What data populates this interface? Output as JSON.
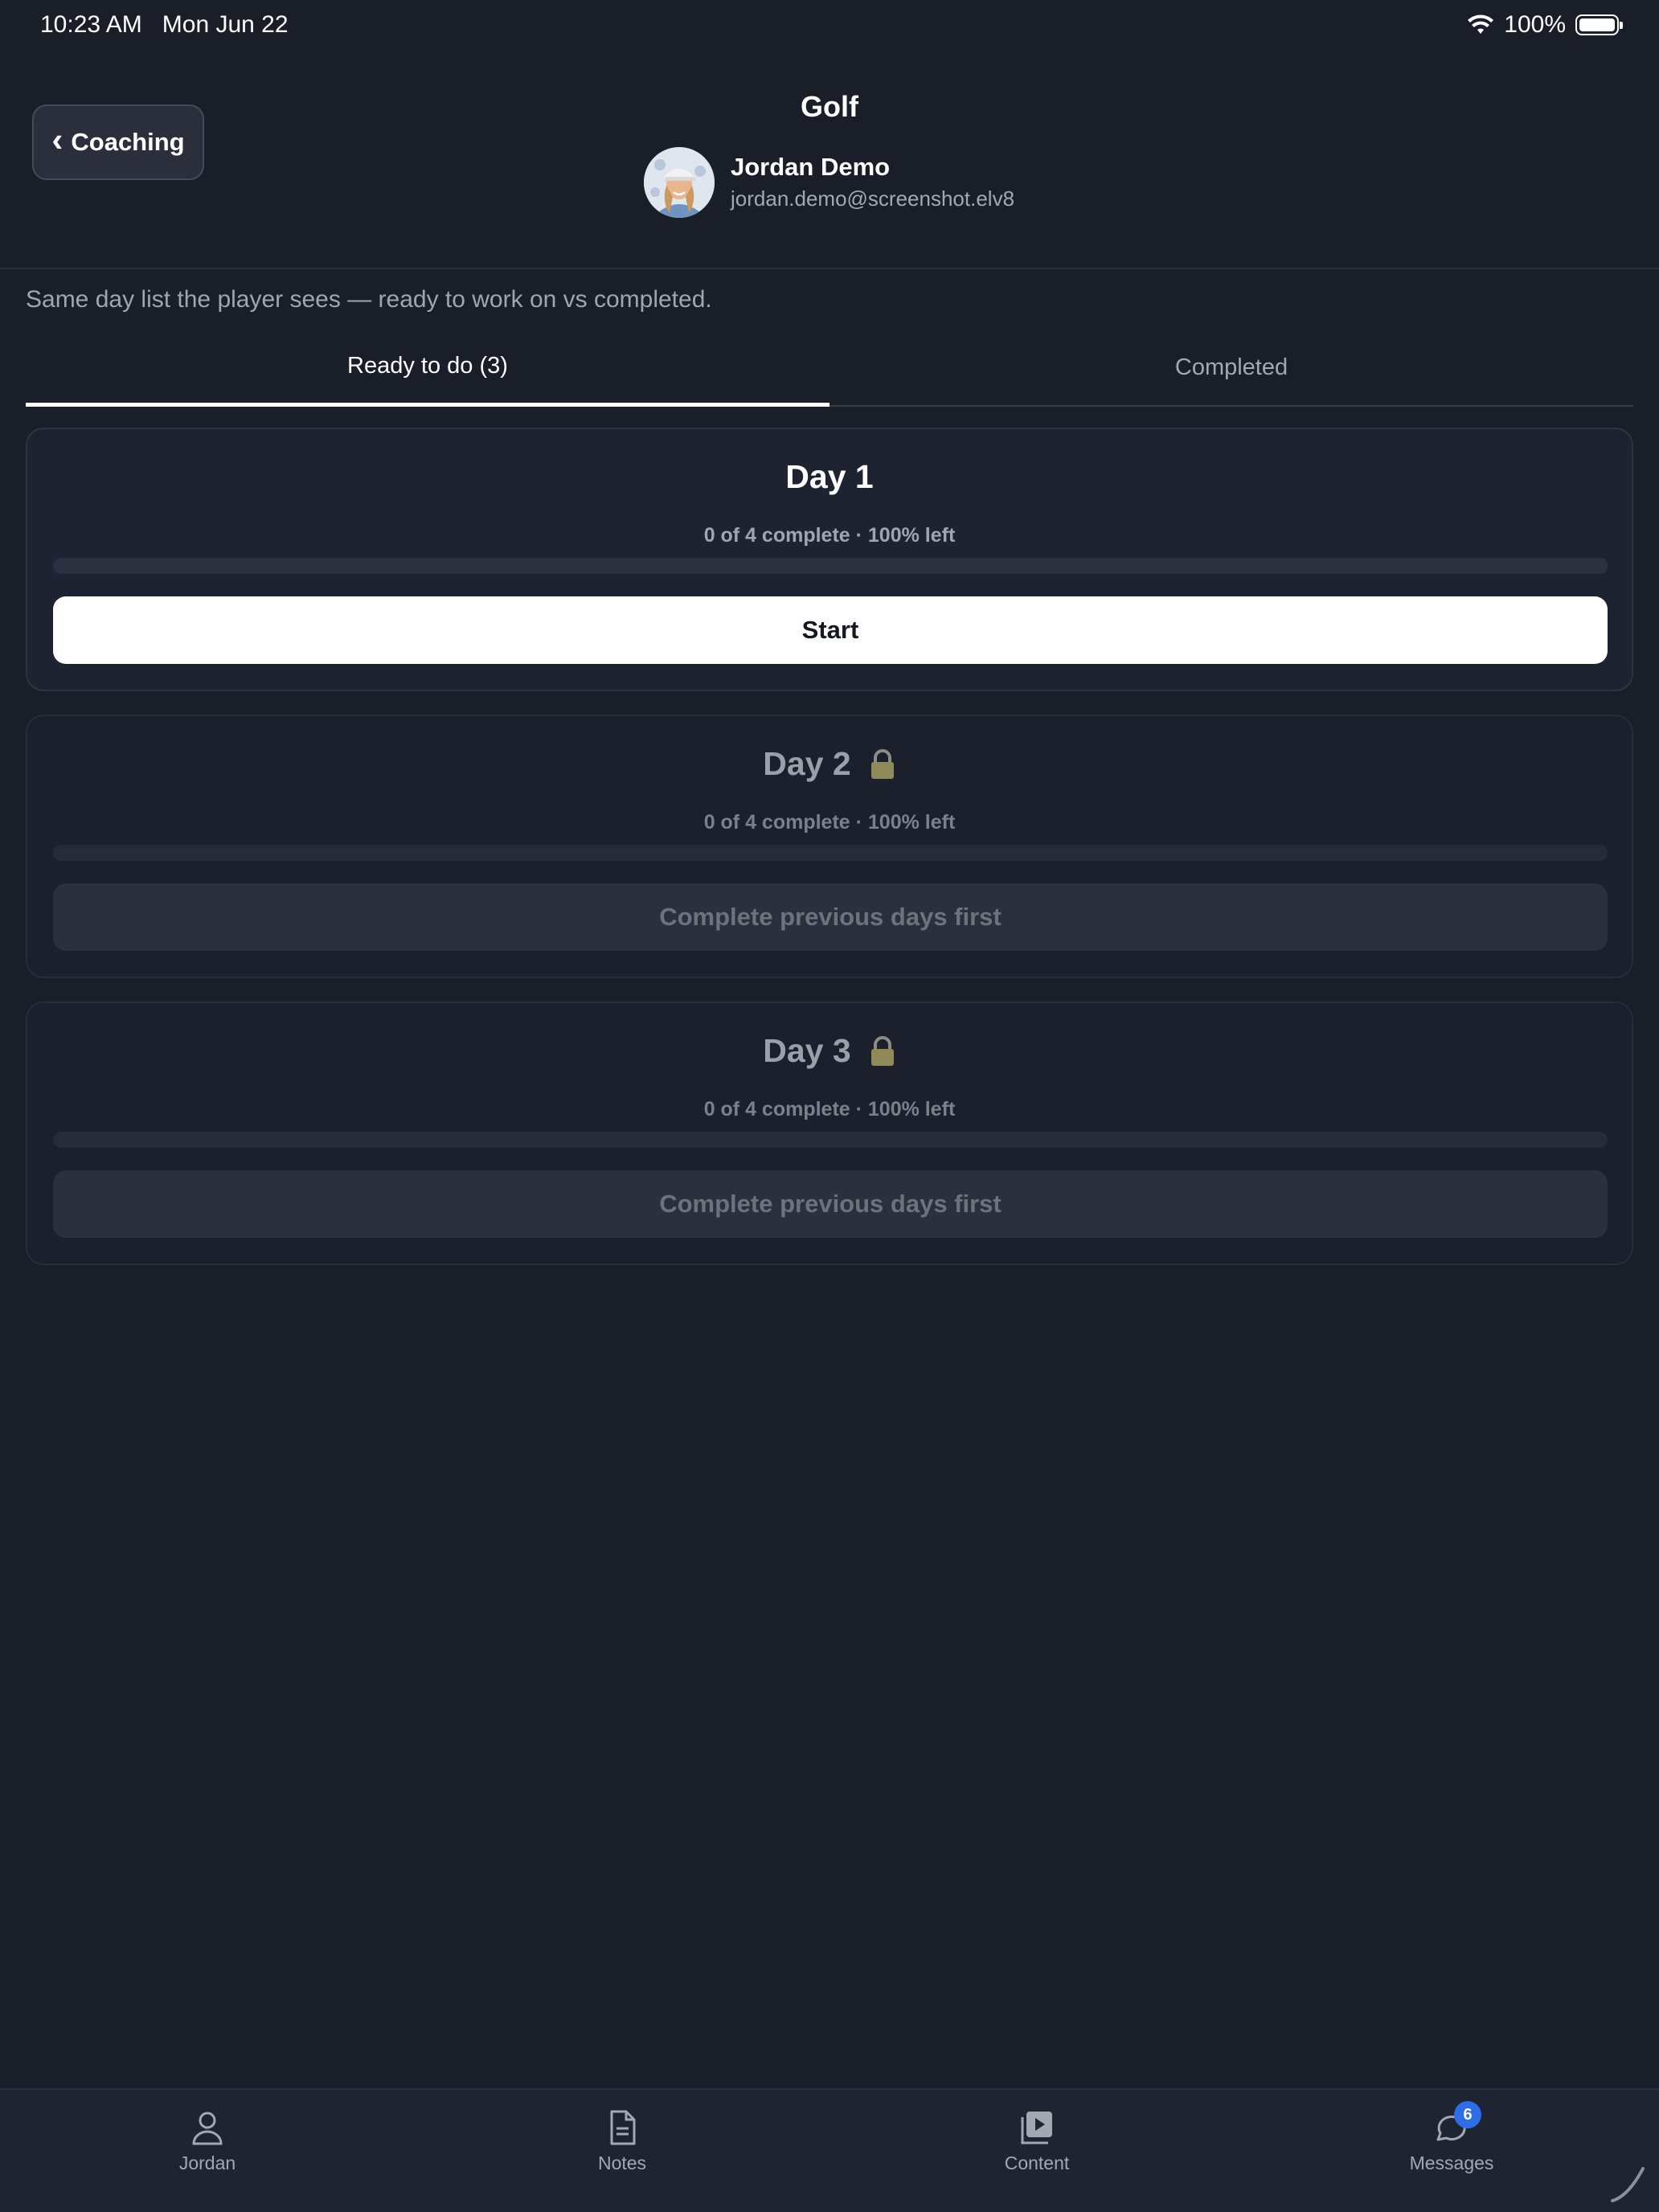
{
  "status_bar": {
    "time": "10:23 AM",
    "date": "Mon Jun 22",
    "battery": "100%"
  },
  "header": {
    "back_label": "Coaching",
    "title": "Golf",
    "user_name": "Jordan Demo",
    "user_email": "jordan.demo@screenshot.elv8"
  },
  "description": "Same day list the player sees — ready to work on vs completed.",
  "tabs": [
    {
      "label": "Ready to do (3)",
      "active": true
    },
    {
      "label": "Completed",
      "active": false
    }
  ],
  "days": [
    {
      "title": "Day 1",
      "progress_text": "0 of 4 complete · 100% left",
      "progress": 0,
      "locked": false,
      "action_label": "Start"
    },
    {
      "title": "Day 2",
      "progress_text": "0 of 4 complete · 100% left",
      "progress": 0,
      "locked": true,
      "action_label": "Complete previous days first",
      "icon": "lock-icon"
    },
    {
      "title": "Day 3",
      "progress_text": "0 of 4 complete · 100% left",
      "progress": 0,
      "locked": true,
      "action_label": "Complete previous days first",
      "icon": "lock-icon"
    }
  ],
  "bottom_nav": [
    {
      "label": "Jordan",
      "icon": "person-icon"
    },
    {
      "label": "Notes",
      "icon": "document-icon"
    },
    {
      "label": "Content",
      "icon": "video-library-icon"
    },
    {
      "label": "Messages",
      "icon": "chat-bubbles-icon",
      "badge": "6"
    }
  ],
  "colors": {
    "background": "#191e29",
    "card": "#1e2331",
    "accent": "#2e6de6",
    "primary_button": "#ffffff"
  }
}
